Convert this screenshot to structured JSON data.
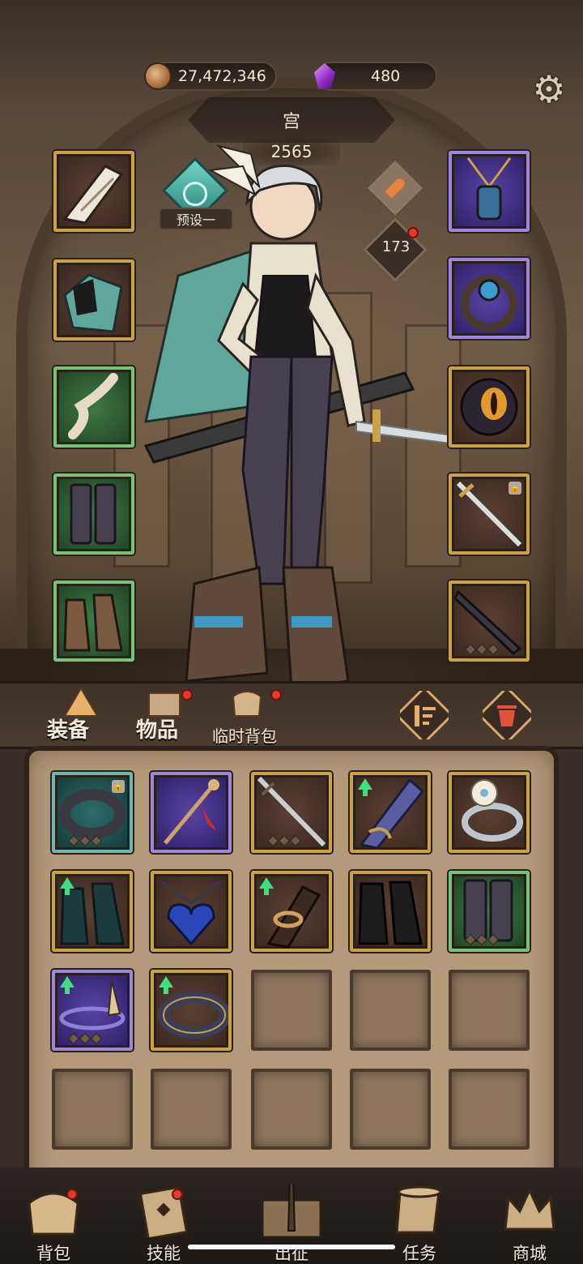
{
  "currency": {
    "gold_icon": "coin-icon",
    "gold_amount": "27,472,346",
    "gem_icon": "purple-gem-icon",
    "gem_amount": "480",
    "settings_icon": "gear-icon"
  },
  "hero": {
    "name": "宫",
    "power": "2565",
    "preset_label": "预设一",
    "level": "173"
  },
  "equipment": {
    "left_slots": [
      "winged-helmet",
      "cloak-armor",
      "bracer",
      "leggings",
      "boots"
    ],
    "right_slots": [
      "amulet",
      "ring",
      "trinket",
      "sword-locked",
      "dagger"
    ]
  },
  "tabs": {
    "equipment": "装备",
    "items": "物品",
    "temp_bag": "临时背包"
  },
  "inventory": [
    {
      "item": "ring",
      "quality": "teal",
      "locked": true,
      "upgrade": false
    },
    {
      "item": "hairpin",
      "quality": "purple",
      "locked": false,
      "upgrade": false
    },
    {
      "item": "sword",
      "quality": "brown",
      "locked": false,
      "upgrade": false
    },
    {
      "item": "vambrace",
      "quality": "brown",
      "locked": false,
      "upgrade": true
    },
    {
      "item": "flower-ring",
      "quality": "brown",
      "locked": false,
      "upgrade": false
    },
    {
      "item": "boots",
      "quality": "brown",
      "locked": false,
      "upgrade": true
    },
    {
      "item": "heart-necklace",
      "quality": "brown",
      "locked": false,
      "upgrade": false
    },
    {
      "item": "horn-bracer",
      "quality": "brown",
      "locked": false,
      "upgrade": true
    },
    {
      "item": "dark-boots",
      "quality": "brown",
      "locked": false,
      "upgrade": false
    },
    {
      "item": "leggings",
      "quality": "green",
      "locked": false,
      "upgrade": false
    },
    {
      "item": "circlet",
      "quality": "purple",
      "locked": false,
      "upgrade": true
    },
    {
      "item": "band",
      "quality": "brown",
      "locked": false,
      "upgrade": true
    }
  ],
  "nav": {
    "bag": "背包",
    "skills": "技能",
    "expedition": "出征",
    "quests": "任务",
    "shop": "商城"
  }
}
